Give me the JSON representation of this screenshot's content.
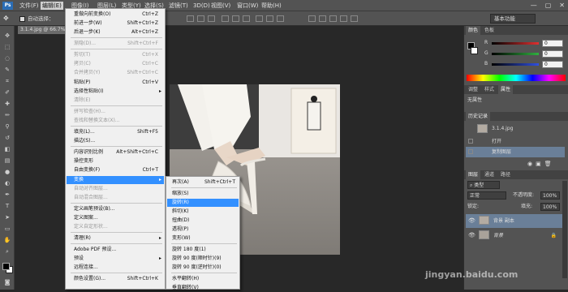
{
  "app": {
    "logo": "Ps"
  },
  "menubar": {
    "items": [
      "文件(F)",
      "编辑(E)",
      "图像(I)",
      "图层(L)",
      "类型(Y)",
      "选择(S)",
      "滤镜(T)",
      "3D(D)",
      "视图(V)",
      "窗口(W)",
      "帮助(H)"
    ],
    "active_index": 1
  },
  "window_controls": {
    "minimize": "—",
    "maximize": "▢",
    "close": "✕"
  },
  "options_bar": {
    "auto_select": "自动选择：",
    "workspace": "基本功能"
  },
  "document": {
    "tab_title": "3.1.4.jpg @ 66.7% (背景 副本, RGB/8)"
  },
  "edit_menu": {
    "items": [
      {
        "label": "重做向前变换(O)",
        "shortcut": "Ctrl+Z",
        "disabled": false
      },
      {
        "label": "前进一步(W)",
        "shortcut": "Shift+Ctrl+Z",
        "disabled": false
      },
      {
        "label": "后退一步(K)",
        "shortcut": "Alt+Ctrl+Z",
        "disabled": false
      },
      {
        "label": "渐隐(D)...",
        "shortcut": "Shift+Ctrl+F",
        "disabled": true
      },
      {
        "label": "剪切(T)",
        "shortcut": "Ctrl+X",
        "disabled": true
      },
      {
        "label": "拷贝(C)",
        "shortcut": "Ctrl+C",
        "disabled": true
      },
      {
        "label": "合并拷贝(Y)",
        "shortcut": "Shift+Ctrl+C",
        "disabled": true
      },
      {
        "label": "粘贴(P)",
        "shortcut": "Ctrl+V",
        "disabled": false
      },
      {
        "label": "选择性粘贴(I)",
        "shortcut": "",
        "disabled": false,
        "submenu": true
      },
      {
        "label": "清除(E)",
        "shortcut": "",
        "disabled": true
      },
      {
        "label": "拼写检查(H)...",
        "shortcut": "",
        "disabled": true
      },
      {
        "label": "查找和替换文本(X)...",
        "shortcut": "",
        "disabled": true
      },
      {
        "label": "填充(L)...",
        "shortcut": "Shift+F5",
        "disabled": false
      },
      {
        "label": "描边(S)...",
        "shortcut": "",
        "disabled": false
      },
      {
        "label": "内容识别比例",
        "shortcut": "Alt+Shift+Ctrl+C",
        "disabled": false
      },
      {
        "label": "操控变形",
        "shortcut": "",
        "disabled": false
      },
      {
        "label": "自由变换(F)",
        "shortcut": "Ctrl+T",
        "disabled": false
      },
      {
        "label": "变换",
        "shortcut": "",
        "disabled": false,
        "submenu": true,
        "highlighted": true
      },
      {
        "label": "自动对齐图层...",
        "shortcut": "",
        "disabled": true
      },
      {
        "label": "自动混合图层...",
        "shortcut": "",
        "disabled": true
      },
      {
        "label": "定义画笔预设(B)...",
        "shortcut": "",
        "disabled": false
      },
      {
        "label": "定义图案...",
        "shortcut": "",
        "disabled": false
      },
      {
        "label": "定义自定形状...",
        "shortcut": "",
        "disabled": true
      },
      {
        "label": "清理(R)",
        "shortcut": "",
        "disabled": false,
        "submenu": true
      },
      {
        "label": "Adobe PDF 预设...",
        "shortcut": "",
        "disabled": false
      },
      {
        "label": "预设",
        "shortcut": "",
        "disabled": false,
        "submenu": true
      },
      {
        "label": "远程连接...",
        "shortcut": "",
        "disabled": false
      },
      {
        "label": "颜色设置(G)...",
        "shortcut": "Shift+Ctrl+K",
        "disabled": false
      }
    ]
  },
  "transform_submenu": {
    "items": [
      {
        "label": "再次(A)",
        "shortcut": "Shift+Ctrl+T"
      },
      {
        "label": "缩放(S)",
        "shortcut": ""
      },
      {
        "label": "旋转(R)",
        "shortcut": "",
        "highlighted": true
      },
      {
        "label": "斜切(K)",
        "shortcut": ""
      },
      {
        "label": "扭曲(D)",
        "shortcut": ""
      },
      {
        "label": "透视(P)",
        "shortcut": ""
      },
      {
        "label": "变形(W)",
        "shortcut": ""
      },
      {
        "label": "旋转 180 度(1)",
        "shortcut": ""
      },
      {
        "label": "旋转 90 度(顺时针)(9)",
        "shortcut": ""
      },
      {
        "label": "旋转 90 度(逆时针)(0)",
        "shortcut": ""
      },
      {
        "label": "水平翻转(H)",
        "shortcut": ""
      },
      {
        "label": "垂直翻转(V)",
        "shortcut": ""
      }
    ]
  },
  "color_panel": {
    "tabs": [
      "颜色",
      "色板"
    ],
    "channels": [
      {
        "label": "R",
        "value": "0",
        "color": "#e03030"
      },
      {
        "label": "G",
        "value": "0",
        "color": "#30b040"
      },
      {
        "label": "B",
        "value": "0",
        "color": "#3050e0"
      }
    ]
  },
  "adjust_panel": {
    "tabs": [
      "调整",
      "样式",
      "属性"
    ],
    "content": "无属性"
  },
  "history_panel": {
    "tab": "历史记录",
    "snapshot": "3.1.4.jpg",
    "steps": [
      "打开",
      "复制图层"
    ]
  },
  "layers_panel": {
    "tabs": [
      "图层",
      "通道",
      "路径"
    ],
    "kind": "类型",
    "blend_mode": "正常",
    "opacity_label": "不透明度:",
    "opacity": "100%",
    "lock_label": "锁定:",
    "fill_label": "填充:",
    "fill": "100%",
    "layers": [
      {
        "name": "背景 副本",
        "selected": true
      },
      {
        "name": "背景",
        "selected": false
      }
    ]
  },
  "watermark": "jingyan.baidu.com"
}
